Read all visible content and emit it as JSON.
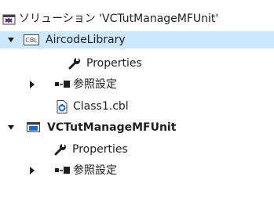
{
  "solution": {
    "label": "ソリューション 'VCTutManageMFUnit'",
    "icon": "solution-icon"
  },
  "projects": [
    {
      "name": "AircodeLibrary",
      "icon": "cbl-project-icon",
      "icon_text": "CBL",
      "items": {
        "properties": "Properties",
        "references": "参照設定",
        "file": "Class1.cbl"
      }
    },
    {
      "name": "VCTutManageMFUnit",
      "icon": "app-project-icon",
      "items": {
        "properties": "Properties",
        "references": "参照設定"
      }
    }
  ],
  "colors": {
    "selection": "#cce8ff",
    "file_icon": "#1b6ac9",
    "vs_purple": "#68217a"
  }
}
